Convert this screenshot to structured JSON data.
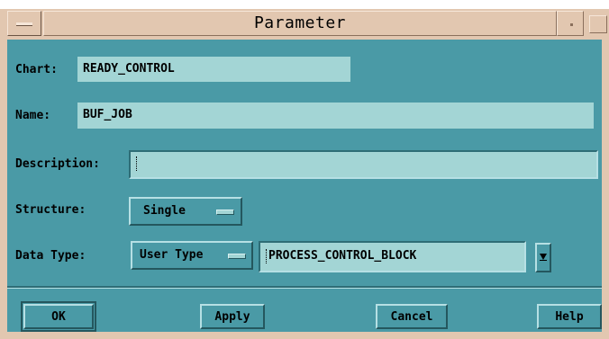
{
  "window": {
    "title": "Parameter"
  },
  "form": {
    "chart_label": "Chart:",
    "chart_value": "READY_CONTROL",
    "name_label": "Name:",
    "name_value": "BUF_JOB",
    "description_label": "Description:",
    "description_value": "",
    "structure_label": "Structure:",
    "structure_value": "Single",
    "data_type_label": "Data Type:",
    "data_type_value": "User Type",
    "user_type_value": "PROCESS_CONTROL_BLOCK"
  },
  "buttons": {
    "ok": "OK",
    "apply": "Apply",
    "cancel": "Cancel",
    "help": "Help"
  },
  "colors": {
    "dialog_bg": "#4a9aa6",
    "field_bg": "#a3d5d5",
    "title_bg": "#e2c7b0"
  }
}
